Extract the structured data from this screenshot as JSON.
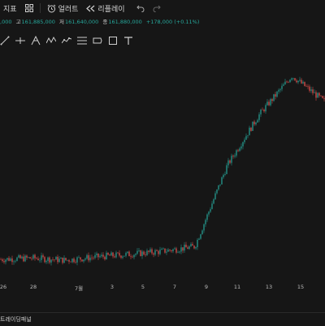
{
  "toolbar": {
    "indicators_label": "지표",
    "grid_icon": "grid-icon",
    "alert_label": "얼러트",
    "replay_label": "리플레이",
    "undo_icon": "undo-icon",
    "redo_icon": "redo-icon"
  },
  "ohlc": {
    "open_value": ",000",
    "high_key": "고",
    "high_value": "161,885,000",
    "low_key": "저",
    "low_value": "161,640,000",
    "close_key": "종",
    "close_value": "161,880,000",
    "change": "+178,000 (+0.11%)"
  },
  "drawing_tools": [
    "trendline-icon",
    "crosshair-line-icon",
    "pitchfork-icon",
    "pattern-icon",
    "fibonacci-icon",
    "parallel-channel-icon",
    "rectangle-icon",
    "text-icon"
  ],
  "colors": {
    "up": "#26a69a",
    "down": "#ef5350",
    "background": "#161616"
  },
  "x_axis": [
    "26",
    "28",
    "7월",
    "3",
    "5",
    "7",
    "9",
    "11",
    "13",
    "15"
  ],
  "bottom_bar": {
    "panel_label": "트레이딩패널"
  },
  "chart_data": {
    "type": "candlestick",
    "categories": [
      "26",
      "28",
      "7월",
      "3",
      "5",
      "7",
      "9",
      "11",
      "13",
      "15"
    ],
    "series": [
      {
        "values": [
          112000000,
          112300000,
          111800000,
          112600000,
          113200000,
          113900000,
          115000000,
          134000000,
          146000000,
          155000000,
          149000000
        ]
      }
    ]
  }
}
